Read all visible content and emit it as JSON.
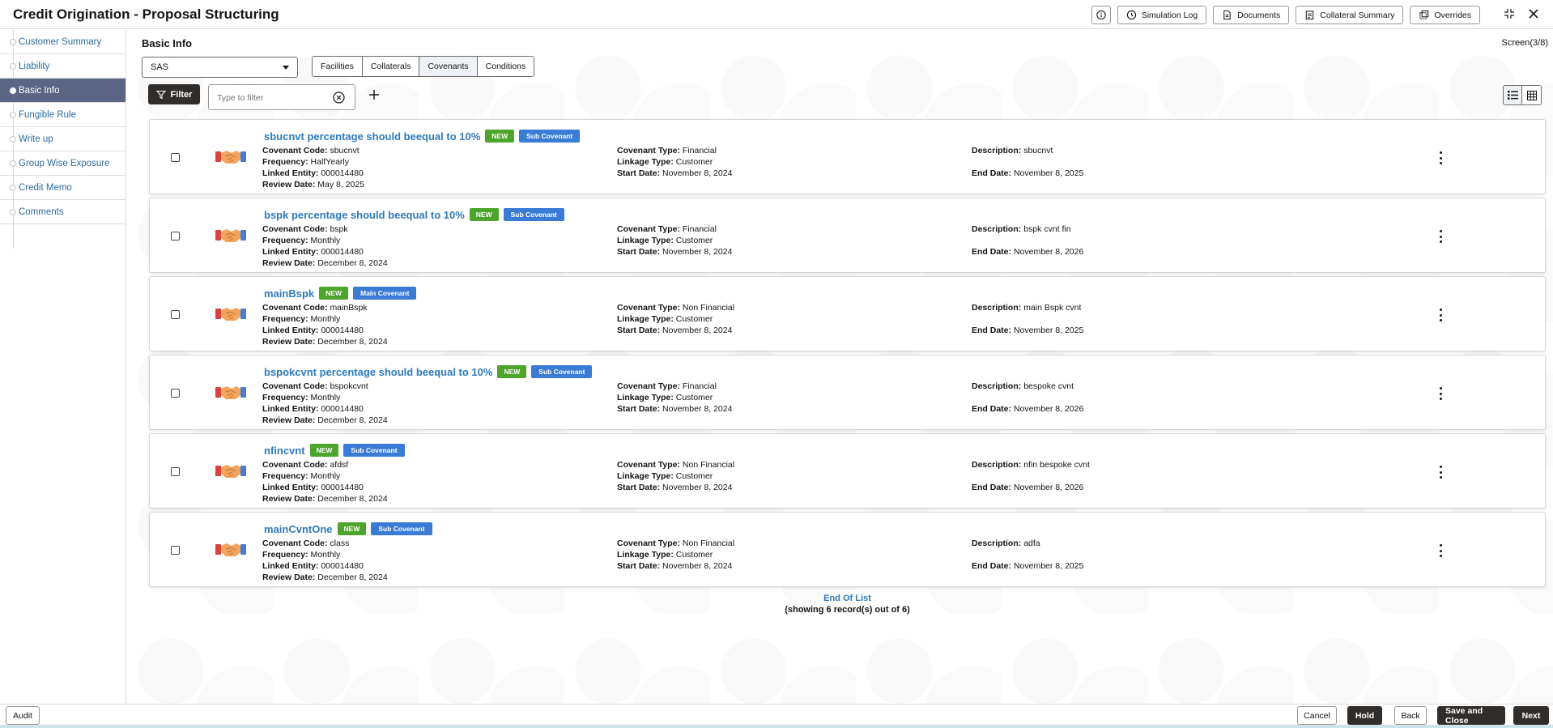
{
  "header": {
    "title": "Credit Origination - Proposal Structuring",
    "buttons": {
      "simulation_log": "Simulation Log",
      "documents": "Documents",
      "collateral_summary": "Collateral Summary",
      "overrides": "Overrides"
    }
  },
  "sidebar": {
    "items": [
      {
        "label": "Customer Summary",
        "active": false
      },
      {
        "label": "Liability",
        "active": false
      },
      {
        "label": "Basic Info",
        "active": true
      },
      {
        "label": "Fungible Rule",
        "active": false
      },
      {
        "label": "Write up",
        "active": false
      },
      {
        "label": "Group Wise Exposure",
        "active": false
      },
      {
        "label": "Credit Memo",
        "active": false
      },
      {
        "label": "Comments",
        "active": false
      }
    ]
  },
  "main": {
    "section_title": "Basic Info",
    "screen_indicator": "Screen(3/8)",
    "select_value": "SAS",
    "tabs": [
      "Facilities",
      "Collaterals",
      "Covenants",
      "Conditions"
    ],
    "selected_tab": "Covenants",
    "filter_label": "Filter",
    "filter_placeholder": "Type to filter"
  },
  "labels": {
    "covenant_code": "Covenant Code:",
    "frequency": "Frequency:",
    "linked_entity": "Linked Entity:",
    "review_date": "Review Date:",
    "covenant_type": "Covenant Type:",
    "linkage_type": "Linkage Type:",
    "start_date": "Start Date:",
    "description": "Description:",
    "end_date": "End Date:"
  },
  "covenants": [
    {
      "title": "sbucnvt percentage should beequal to 10%",
      "status": "NEW",
      "kind": "Sub Covenant",
      "code": "sbucnvt",
      "frequency": "HalfYearly",
      "linked_entity": "000014480",
      "review_date": "May 8, 2025",
      "covenant_type": "Financial",
      "linkage_type": "Customer",
      "start_date": "November 8, 2024",
      "description": "sbucnvt",
      "end_date": "November 8, 2025"
    },
    {
      "title": "bspk percentage should beequal to 10%",
      "status": "NEW",
      "kind": "Sub Covenant",
      "code": "bspk",
      "frequency": "Monthly",
      "linked_entity": "000014480",
      "review_date": "December 8, 2024",
      "covenant_type": "Financial",
      "linkage_type": "Customer",
      "start_date": "November 8, 2024",
      "description": "bspk cvnt fin",
      "end_date": "November 8, 2026"
    },
    {
      "title": "mainBspk",
      "status": "NEW",
      "kind": "Main Covenant",
      "code": "mainBspk",
      "frequency": "Monthly",
      "linked_entity": "000014480",
      "review_date": "December 8, 2024",
      "covenant_type": "Non Financial",
      "linkage_type": "Customer",
      "start_date": "November 8, 2024",
      "description": "main Bspk cvnt",
      "end_date": "November 8, 2025"
    },
    {
      "title": "bspokcvnt percentage should beequal to 10%",
      "status": "NEW",
      "kind": "Sub Covenant",
      "code": "bspokcvnt",
      "frequency": "Monthly",
      "linked_entity": "000014480",
      "review_date": "December 8, 2024",
      "covenant_type": "Financial",
      "linkage_type": "Customer",
      "start_date": "November 8, 2024",
      "description": "bespoke cvnt",
      "end_date": "November 8, 2026"
    },
    {
      "title": "nfincvnt",
      "status": "NEW",
      "kind": "Sub Covenant",
      "code": "afdsf",
      "frequency": "Monthly",
      "linked_entity": "000014480",
      "review_date": "December 8, 2024",
      "covenant_type": "Non Financial",
      "linkage_type": "Customer",
      "start_date": "November 8, 2024",
      "description": "nfin bespoke cvnt",
      "end_date": "November 8, 2026"
    },
    {
      "title": "mainCvntOne",
      "status": "NEW",
      "kind": "Sub Covenant",
      "code": "class",
      "frequency": "Monthly",
      "linked_entity": "000014480",
      "review_date": "December 8, 2024",
      "covenant_type": "Non Financial",
      "linkage_type": "Customer",
      "start_date": "November 8, 2024",
      "description": "adfa",
      "end_date": "November 8, 2025"
    }
  ],
  "list_footer": {
    "end_text": "End Of List",
    "count_text": "(showing 6 record(s) out of 6)"
  },
  "footer": {
    "audit": "Audit",
    "cancel": "Cancel",
    "hold": "Hold",
    "back": "Back",
    "save_close": "Save and Close",
    "next": "Next"
  },
  "colors": {
    "accent_link": "#2e7bbd",
    "badge_new": "#4ea52d",
    "badge_covenant": "#3a7bd5",
    "active_nav": "#5b6583",
    "dark_button": "#312d2a"
  }
}
